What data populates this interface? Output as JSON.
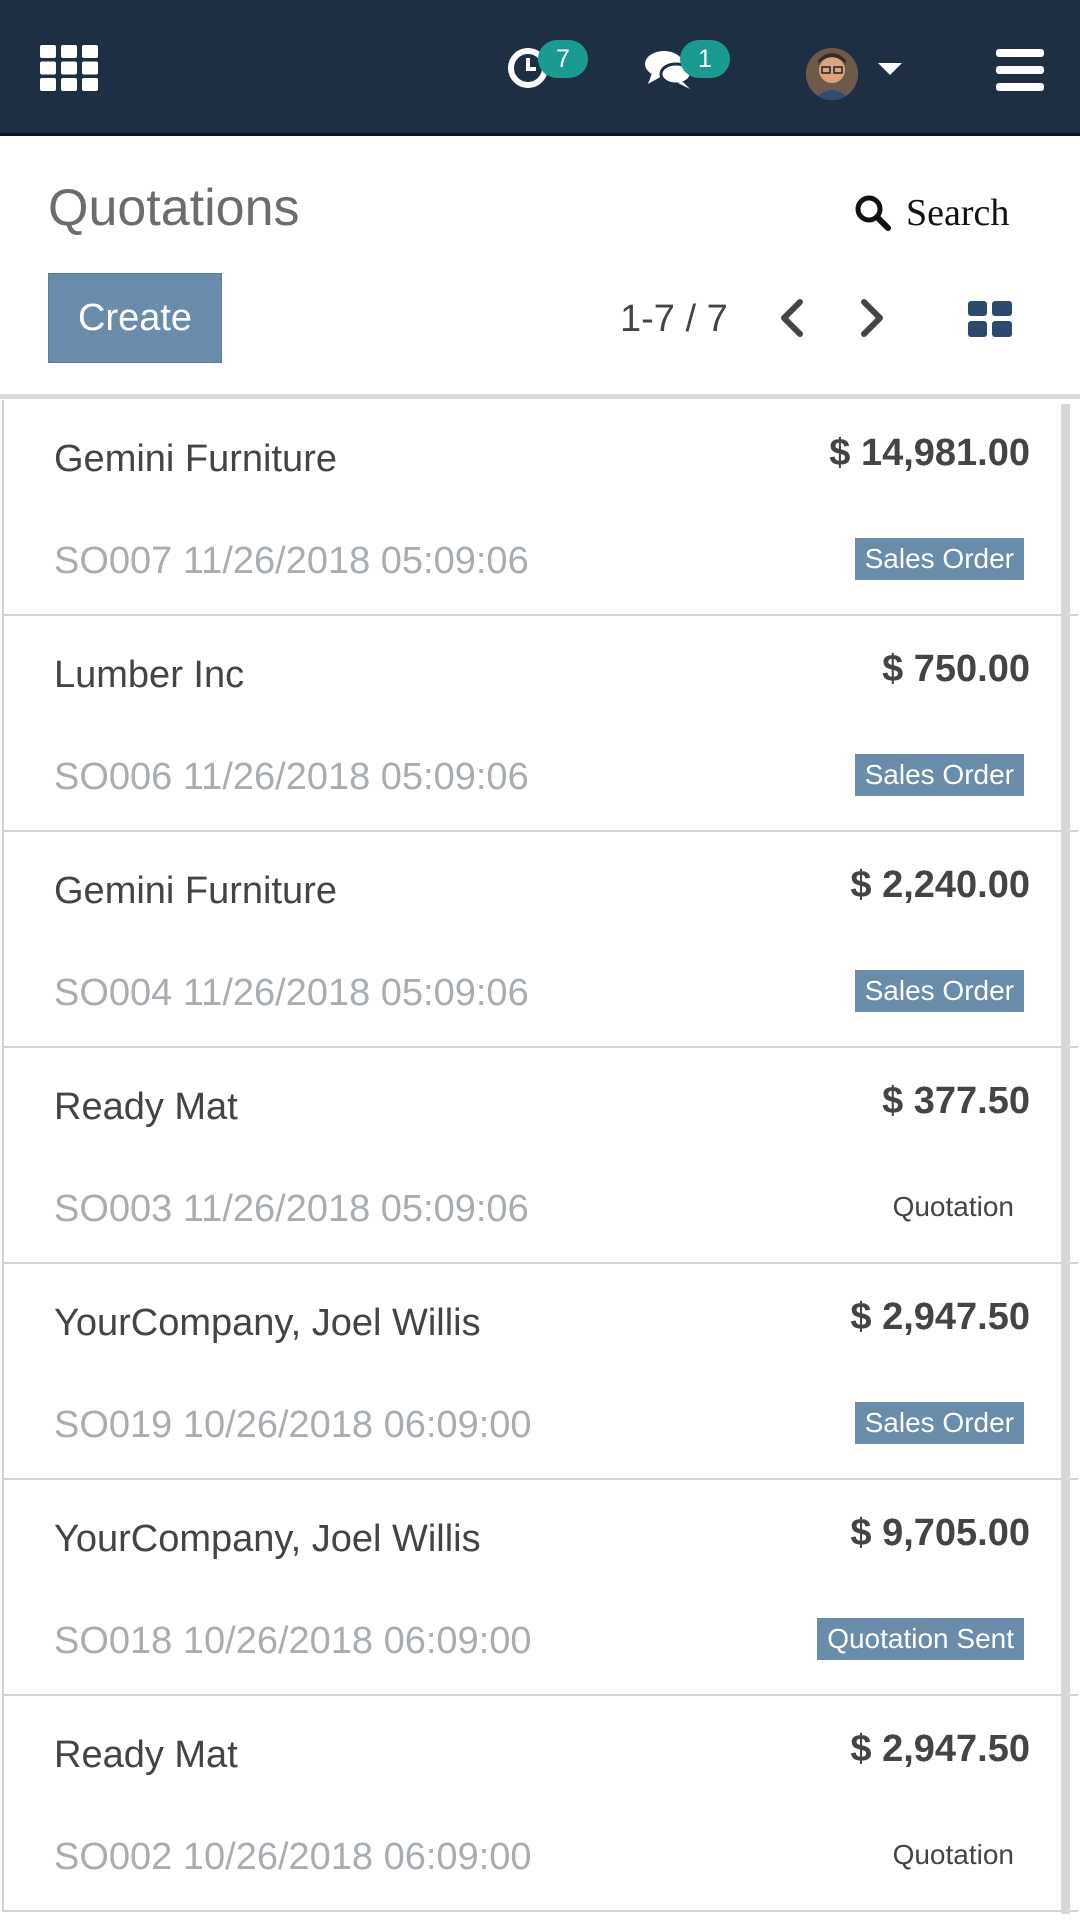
{
  "navbar": {
    "activity_count": "7",
    "messages_count": "1"
  },
  "control_panel": {
    "title": "Quotations",
    "search_label": "Search",
    "create_label": "Create",
    "pager": "1-7 / 7"
  },
  "colors": {
    "navbar": "#1e2e43",
    "badge": "#1b9a91",
    "primary": "#6a8cab"
  },
  "rows": [
    {
      "name": "Gemini Furniture",
      "amount": "$ 14,981.00",
      "ref": "SO007 11/26/2018 05:09:06",
      "status": "Sales Order"
    },
    {
      "name": "Lumber Inc",
      "amount": "$ 750.00",
      "ref": "SO006 11/26/2018 05:09:06",
      "status": "Sales Order"
    },
    {
      "name": "Gemini Furniture",
      "amount": "$ 2,240.00",
      "ref": "SO004 11/26/2018 05:09:06",
      "status": "Sales Order"
    },
    {
      "name": "Ready Mat",
      "amount": "$ 377.50",
      "ref": "SO003 11/26/2018 05:09:06",
      "status": "Quotation"
    },
    {
      "name": "YourCompany, Joel Willis",
      "amount": "$ 2,947.50",
      "ref": "SO019 10/26/2018 06:09:00",
      "status": "Sales Order"
    },
    {
      "name": "YourCompany, Joel Willis",
      "amount": "$ 9,705.00",
      "ref": "SO018 10/26/2018 06:09:00",
      "status": "Quotation Sent"
    },
    {
      "name": "Ready Mat",
      "amount": "$ 2,947.50",
      "ref": "SO002 10/26/2018 06:09:00",
      "status": "Quotation"
    }
  ]
}
